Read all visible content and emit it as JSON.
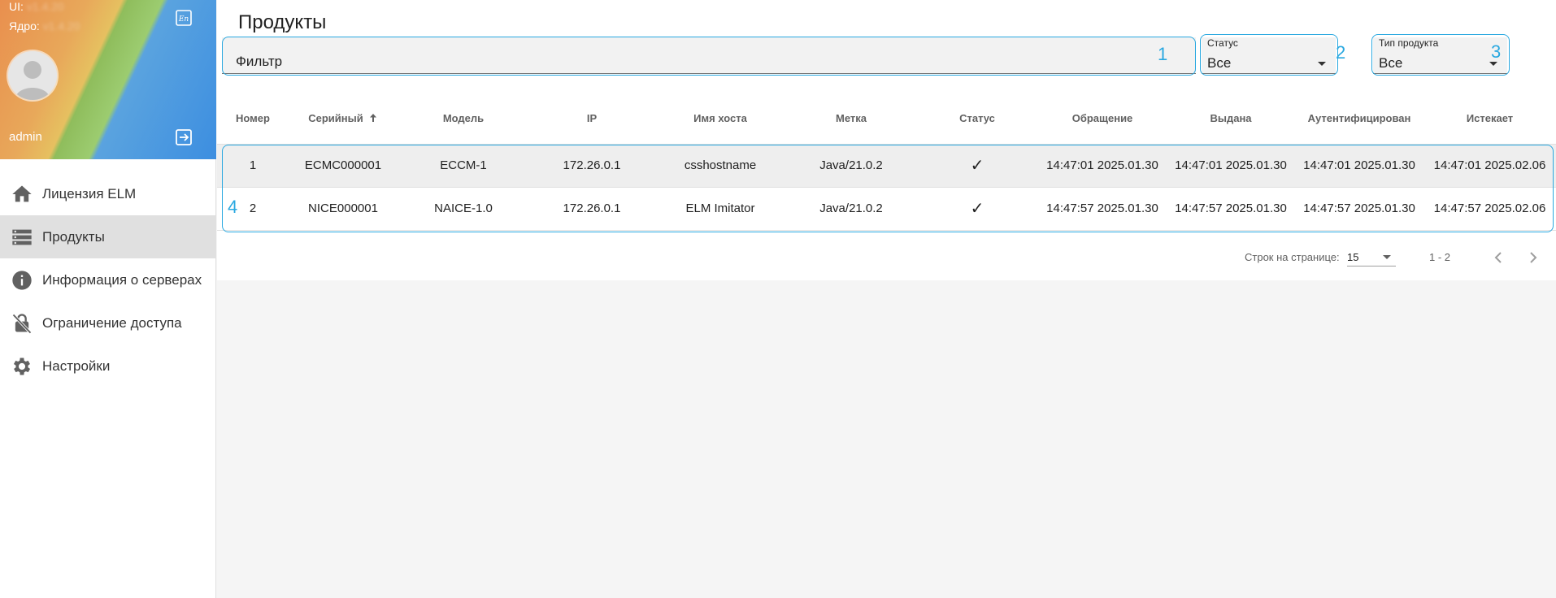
{
  "sidebar": {
    "ui_version_label": "UI:",
    "ui_version_value": "v1.4.20",
    "core_version_label": "Ядро:",
    "core_version_value": "v1.4.20",
    "username": "admin",
    "items": [
      {
        "label": "Лицензия ELM",
        "icon": "home-icon"
      },
      {
        "label": "Продукты",
        "icon": "storage-icon",
        "active": true
      },
      {
        "label": "Информация о серверах",
        "icon": "info-icon"
      },
      {
        "label": "Ограничение доступа",
        "icon": "lock-off-icon"
      },
      {
        "label": "Настройки",
        "icon": "gear-icon"
      }
    ]
  },
  "main": {
    "title": "Продукты",
    "filter": {
      "value": "Фильтр"
    },
    "status": {
      "label": "Статус",
      "value": "Все"
    },
    "product_type": {
      "label": "Тип продукта",
      "value": "Все"
    },
    "callouts": [
      "1",
      "2",
      "3",
      "4"
    ],
    "table": {
      "columns": [
        "Номер",
        "Серийный",
        "Модель",
        "IP",
        "Имя хоста",
        "Метка",
        "Статус",
        "Обращение",
        "Выдана",
        "Аутентифицирован",
        "Истекает"
      ],
      "rows": [
        [
          "1",
          "ECMC000001",
          "ECCM-1",
          "172.26.0.1",
          "csshostname",
          "Java/21.0.2",
          "✓",
          "14:47:01 2025.01.30",
          "14:47:01 2025.01.30",
          "14:47:01 2025.01.30",
          "14:47:01 2025.02.06"
        ],
        [
          "2",
          "NICE000001",
          "NAICE-1.0",
          "172.26.0.1",
          "ELM Imitator",
          "Java/21.0.2",
          "✓",
          "14:47:57 2025.01.30",
          "14:47:57 2025.01.30",
          "14:47:57 2025.01.30",
          "14:47:57 2025.02.06"
        ]
      ]
    },
    "pager": {
      "rows_per_page_label": "Строк на странице:",
      "rows_per_page": "15",
      "range": "1 - 2"
    }
  },
  "colors": {
    "accent": "#29a8e0",
    "active_nav": "#e0e0e0"
  }
}
